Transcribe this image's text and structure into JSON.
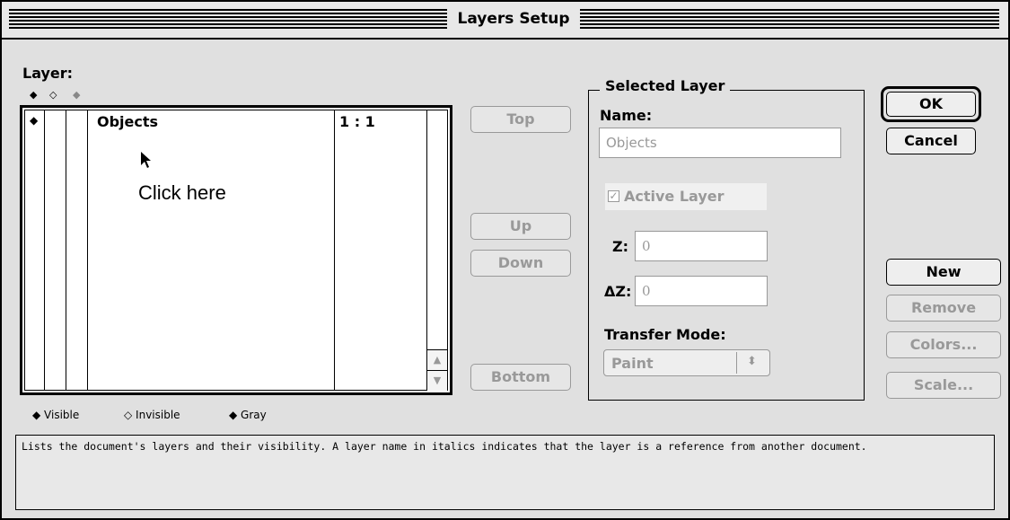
{
  "window": {
    "title": "Layers Setup"
  },
  "layer_panel": {
    "label": "Layer:",
    "column_icons": [
      "◆",
      "◇",
      "◆"
    ],
    "rows": [
      {
        "visibility": "◆",
        "name": "Objects",
        "scale": "1 : 1"
      }
    ],
    "annotation": "Click here"
  },
  "order_buttons": {
    "top": "Top",
    "up": "Up",
    "down": "Down",
    "bottom": "Bottom"
  },
  "selected_layer": {
    "group_title": "Selected Layer",
    "name_label": "Name:",
    "name_value": "Objects",
    "active_label": "Active Layer",
    "active_checked": true,
    "z_label": "Z:",
    "z_value": "0",
    "dz_label": "ΔZ:",
    "dz_value": "0",
    "transfer_label": "Transfer Mode:",
    "transfer_value": "Paint"
  },
  "dialog_buttons": {
    "ok": "OK",
    "cancel": "Cancel",
    "new": "New",
    "remove": "Remove",
    "colors": "Colors...",
    "scale": "Scale..."
  },
  "legend": {
    "visible": "◆ Visible",
    "invisible": "◇ Invisible",
    "gray": "◆ Gray"
  },
  "help_text": "Lists the document's layers and their visibility.  A layer name in italics indicates that the layer is a reference from another document."
}
